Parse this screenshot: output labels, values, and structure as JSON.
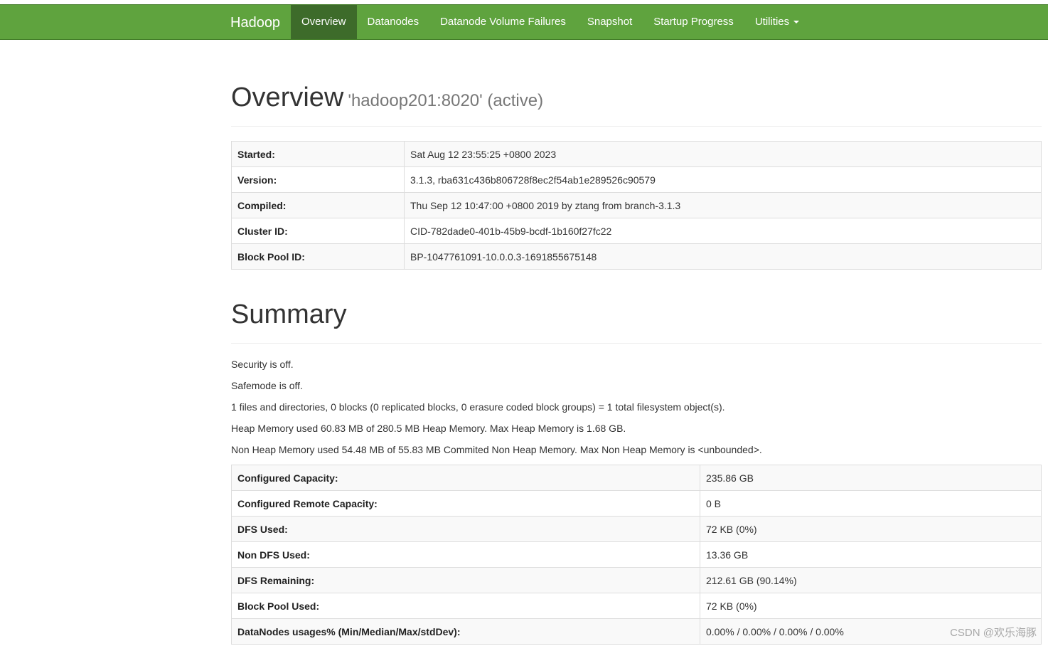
{
  "navbar": {
    "brand": "Hadoop",
    "items": [
      {
        "label": "Overview",
        "active": true
      },
      {
        "label": "Datanodes",
        "active": false
      },
      {
        "label": "Datanode Volume Failures",
        "active": false
      },
      {
        "label": "Snapshot",
        "active": false
      },
      {
        "label": "Startup Progress",
        "active": false
      },
      {
        "label": "Utilities",
        "active": false,
        "dropdown": true
      }
    ],
    "colors": {
      "background": "#5fa33e",
      "active": "#3d6b2a"
    }
  },
  "overview": {
    "title": "Overview",
    "subtitle": "'hadoop201:8020' (active)",
    "rows": [
      {
        "label": "Started:",
        "value": "Sat Aug 12 23:55:25 +0800 2023"
      },
      {
        "label": "Version:",
        "value": "3.1.3, rba631c436b806728f8ec2f54ab1e289526c90579"
      },
      {
        "label": "Compiled:",
        "value": "Thu Sep 12 10:47:00 +0800 2019 by ztang from branch-3.1.3"
      },
      {
        "label": "Cluster ID:",
        "value": "CID-782dade0-401b-45b9-bcdf-1b160f27fc22"
      },
      {
        "label": "Block Pool ID:",
        "value": "BP-1047761091-10.0.0.3-1691855675148"
      }
    ]
  },
  "summary": {
    "title": "Summary",
    "lines": [
      "Security is off.",
      "Safemode is off.",
      "1 files and directories, 0 blocks (0 replicated blocks, 0 erasure coded block groups) = 1 total filesystem object(s).",
      "Heap Memory used 60.83 MB of 280.5 MB Heap Memory. Max Heap Memory is 1.68 GB.",
      "Non Heap Memory used 54.48 MB of 55.83 MB Commited Non Heap Memory. Max Non Heap Memory is <unbounded>."
    ],
    "rows": [
      {
        "label": "Configured Capacity:",
        "value": "235.86 GB"
      },
      {
        "label": "Configured Remote Capacity:",
        "value": "0 B"
      },
      {
        "label": "DFS Used:",
        "value": "72 KB (0%)"
      },
      {
        "label": "Non DFS Used:",
        "value": "13.36 GB"
      },
      {
        "label": "DFS Remaining:",
        "value": "212.61 GB (90.14%)"
      },
      {
        "label": "Block Pool Used:",
        "value": "72 KB (0%)"
      },
      {
        "label": "DataNodes usages% (Min/Median/Max/stdDev):",
        "value": "0.00% / 0.00% / 0.00% / 0.00%"
      }
    ]
  },
  "watermark": "CSDN @欢乐海豚"
}
